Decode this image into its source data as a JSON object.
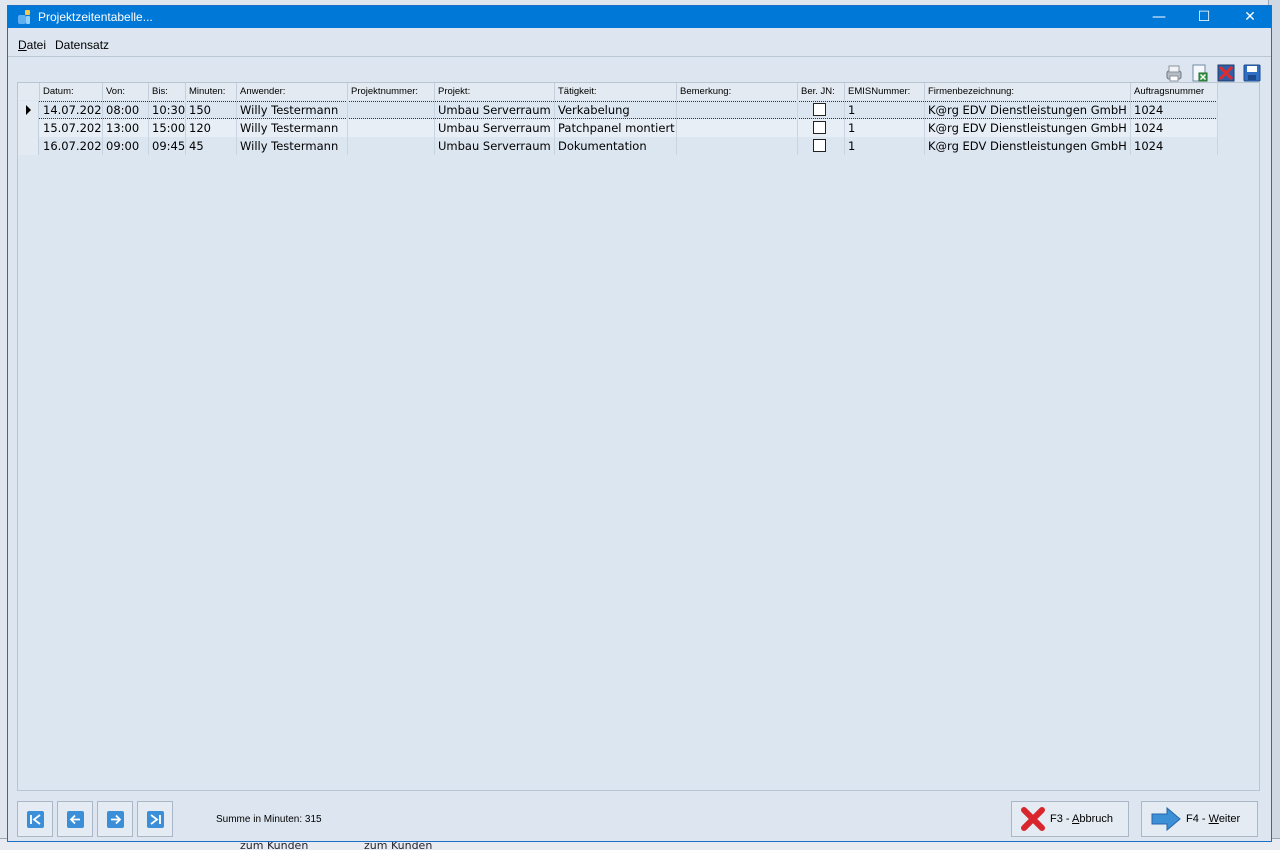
{
  "window": {
    "title": "Projektzeitentabelle...",
    "controls": {
      "minimize": "—",
      "maximize": "☐",
      "close": "✕"
    }
  },
  "menu": {
    "items": [
      {
        "label": "Datei",
        "accel": "D",
        "rest": "atei"
      },
      {
        "label": "Datensatz"
      }
    ]
  },
  "toolbar": {
    "icons": [
      "printer-icon",
      "export-excel-icon",
      "delete-icon",
      "save-icon"
    ]
  },
  "table": {
    "columns": [
      "Datum:",
      "Von:",
      "Bis:",
      "Minuten:",
      "Anwender:",
      "Projektnummer:",
      "Projekt:",
      "Tätigkeit:",
      "Bemerkung:",
      "Ber. JN:",
      "EMISNummer:",
      "Firmenbezeichnung:",
      "Auftragsnummer"
    ],
    "rows": [
      {
        "datum": "14.07.202",
        "von": "08:00",
        "bis": "10:30",
        "minuten": "150",
        "anwender": "Willy Testermann",
        "projektnummer": "",
        "projekt": "Umbau Serverraum",
        "taetigkeit": "Verkabelung",
        "bemerkung": "",
        "berjn": false,
        "emis": "1",
        "firma": "K@rg EDV Dienstleistungen GmbH",
        "auftrag": "1024"
      },
      {
        "datum": "15.07.202",
        "von": "13:00",
        "bis": "15:00",
        "minuten": "120",
        "anwender": "Willy Testermann",
        "projektnummer": "",
        "projekt": "Umbau Serverraum",
        "taetigkeit": "Patchpanel montiert",
        "bemerkung": "",
        "berjn": false,
        "emis": "1",
        "firma": "K@rg EDV Dienstleistungen GmbH",
        "auftrag": "1024"
      },
      {
        "datum": "16.07.202",
        "von": "09:00",
        "bis": "09:45",
        "minuten": "45",
        "anwender": "Willy Testermann",
        "projektnummer": "",
        "projekt": "Umbau Serverraum",
        "taetigkeit": "Dokumentation",
        "bemerkung": "",
        "berjn": false,
        "emis": "1",
        "firma": "K@rg EDV Dienstleistungen GmbH",
        "auftrag": "1024"
      }
    ]
  },
  "footer": {
    "summary": "Summe in Minuten: 315",
    "cancel_button": {
      "prefix": "F3 - ",
      "accel": "A",
      "rest": "bbruch"
    },
    "next_button": {
      "prefix": "F4 - ",
      "accel": "W",
      "rest": "eiter"
    }
  },
  "taskbar": {
    "items": [
      "zum Kunden",
      "zum Kunden"
    ]
  },
  "colors": {
    "titlebar": "#0078d7",
    "window_bg": "#dde6f0",
    "nav_icon": "#3b8ed8",
    "cancel_red": "#d9262c",
    "arrow_blue": "#3d8fd6"
  }
}
